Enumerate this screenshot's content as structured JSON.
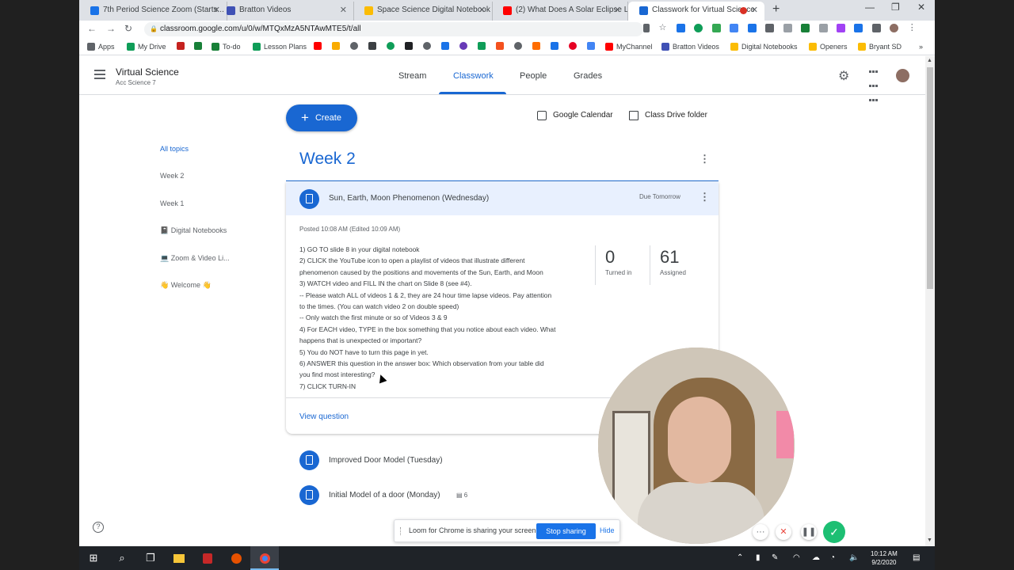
{
  "browser": {
    "tabs": [
      {
        "title": "7th Period Science Zoom (Starts...",
        "favicon_color": "#1a73e8"
      },
      {
        "title": "Bratton Videos",
        "favicon_color": "#3f51b5"
      },
      {
        "title": "Space Science Digital Notebook",
        "favicon_color": "#fbbc04"
      },
      {
        "title": "(2) What Does A Solar Eclipse Lo...",
        "favicon_color": "#ff0000"
      },
      {
        "title": "Classwork for Virtual Science",
        "favicon_color": "#1967d2",
        "recording_color": "#d93025"
      }
    ],
    "address": "classroom.google.com/u/0/w/MTQxMzA5NTAwMTE5/t/all",
    "bookmarks": [
      {
        "label": "Apps",
        "color": "#5f6368"
      },
      {
        "label": "My Drive",
        "color": "#0f9d58"
      },
      {
        "label": "To-do",
        "color": "#188038"
      },
      {
        "label": "Lesson Plans",
        "color": "#0f9d58"
      },
      {
        "label": "MyChannel",
        "color": "#ff0000"
      },
      {
        "label": "Bratton Videos",
        "color": "#3f51b5"
      },
      {
        "label": "Digital Notebooks",
        "color": "#fbbc04"
      },
      {
        "label": "Openers",
        "color": "#fbbc04"
      },
      {
        "label": "Bryant SD",
        "color": "#fbbc04"
      }
    ]
  },
  "classroom": {
    "class_name": "Virtual Science",
    "class_section": "Acc Science 7",
    "nav_tabs": [
      "Stream",
      "Classwork",
      "People",
      "Grades"
    ],
    "create_label": "Create",
    "google_calendar_label": "Google Calendar",
    "class_drive_label": "Class Drive folder",
    "topics": [
      "All topics",
      "Week 2",
      "Week 1",
      "📓 Digital Notebooks",
      "💻 Zoom & Video Li...",
      "👋 Welcome 👋"
    ],
    "week_title": "Week 2",
    "assignment": {
      "title": "Sun, Earth, Moon Phenomenon (Wednesday)",
      "due": "Due Tomorrow",
      "posted": "Posted 10:08 AM (Edited 10:09 AM)",
      "instructions": [
        "1) GO TO slide 8 in your digital notebook",
        "2) CLICK the YouTube icon to open a playlist of videos that illustrate different",
        "phenomenon caused by the positions and movements of the Sun, Earth, and Moon",
        "3) WATCH video and FILL IN the chart on Slide 8 (see #4).",
        "-- Please watch ALL of videos 1 & 2, they are 24 hour time lapse videos.  Pay attention",
        "to the times.  (You can watch video 2 on double speed)",
        "-- Only watch the first minute or so of Videos 3 & 9",
        "4) For EACH video, TYPE in the box something that you notice about each video.  What",
        "happens that is unexpected or important?",
        "5) You do NOT have to turn this page in yet.",
        "6) ANSWER this question in the answer box:   Which observation from your table did",
        "you find most interesting?",
        "7) CLICK TURN-IN"
      ],
      "turned_in": "0",
      "turned_in_label": "Turned in",
      "assigned": "61",
      "assigned_label": "Assigned",
      "view_question": "View question"
    },
    "other_assignments": [
      {
        "title": "Improved Door Model (Tuesday)",
        "comments": ""
      },
      {
        "title": "Initial Model of a door (Monday)",
        "comments": "6"
      }
    ],
    "help_icon": "?"
  },
  "loom": {
    "message": "Loom for Chrome is sharing your screen.",
    "stop_label": "Stop sharing",
    "hide_label": "Hide"
  },
  "taskbar": {
    "time": "10:12 AM",
    "date": "9/2/2020"
  },
  "colors": {
    "accent": "#1967d2",
    "loom_green": "#1dbf73",
    "loom_red": "#e8453c"
  }
}
